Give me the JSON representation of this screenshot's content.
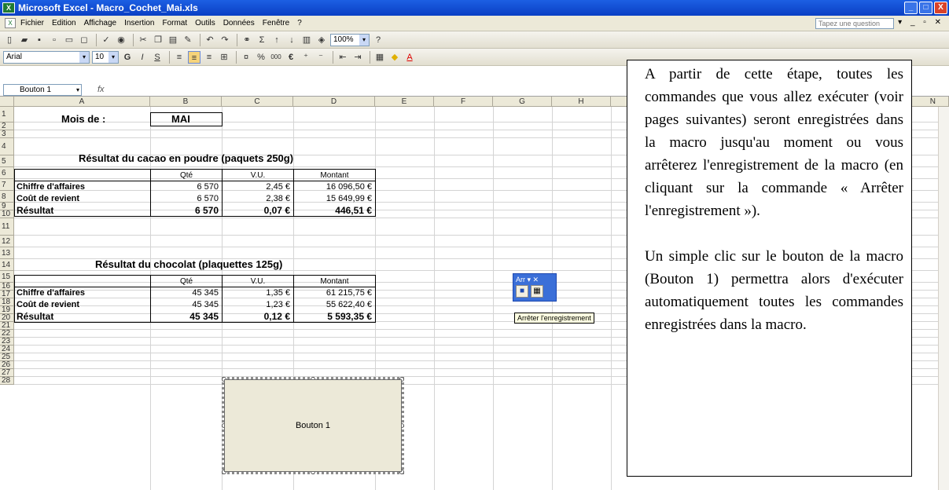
{
  "window": {
    "title": "Microsoft Excel - Macro_Cochet_Mai.xls",
    "min": "_",
    "max": "□",
    "close": "X"
  },
  "menu": {
    "items": [
      "Fichier",
      "Edition",
      "Affichage",
      "Insertion",
      "Format",
      "Outils",
      "Données",
      "Fenêtre",
      "?"
    ],
    "ask_placeholder": "Tapez une question",
    "right": "▾ _ ▫ ✕"
  },
  "toolbar": {
    "zoom": "100%",
    "font": "Arial",
    "size": "10",
    "bold": "G",
    "italic": "I",
    "underline": "S",
    "percent": "%",
    "thousands": "000",
    "euro": "€"
  },
  "formula_bar": {
    "name_box": "Bouton 1",
    "fx": "fx"
  },
  "columns": [
    "A",
    "B",
    "C",
    "D",
    "E",
    "F",
    "G",
    "H",
    "N"
  ],
  "rows": [
    "1",
    "2",
    "3",
    "4",
    "5",
    "6",
    "7",
    "8",
    "9",
    "10",
    "11",
    "12",
    "13",
    "14",
    "15",
    "16",
    "17",
    "18",
    "19",
    "20",
    "21",
    "22",
    "23",
    "24",
    "25",
    "26",
    "27",
    "28"
  ],
  "sheet": {
    "mois_label": "Mois de :",
    "mois_value": "MAI",
    "title1": "Résultat du cacao en poudre (paquets 250g)",
    "title2": "Résultat du chocolat (plaquettes 125g)",
    "hdr_qte": "Qté",
    "hdr_vu": "V.U.",
    "hdr_montant": "Montant",
    "t1": [
      [
        "Chiffre d'affaires",
        "6 570",
        "2,45 €",
        "16 096,50 €"
      ],
      [
        "Coût de revient",
        "6 570",
        "2,38 €",
        "15 649,99 €"
      ],
      [
        "Résultat",
        "6 570",
        "0,07 €",
        "446,51 €"
      ]
    ],
    "t2": [
      [
        "Chiffre d'affaires",
        "45 345",
        "1,35 €",
        "61 215,75 €"
      ],
      [
        "Coût de revient",
        "45 345",
        "1,23 €",
        "55 622,40 €"
      ],
      [
        "Résultat",
        "45 345",
        "0,12 €",
        "5 593,35 €"
      ]
    ]
  },
  "macro_toolbar": {
    "title": "Arr ▾ ✕",
    "tooltip": "Arrêter l'enregistrement"
  },
  "button1": {
    "label": "Bouton 1"
  },
  "note": {
    "p1": "A partir de cette étape, toutes les commandes que vous allez exécuter (voir pages suivantes) seront enregistrées dans la macro jusqu'au moment ou vous arrêterez l'enregistrement de la macro (en cliquant sur la commande « Arrêter l'enregistrement »).",
    "p2": "Un simple clic sur le bouton de la macro (Bouton 1) permettra alors d'exécuter automatiquement toutes les commandes enregistrées dans la macro."
  }
}
